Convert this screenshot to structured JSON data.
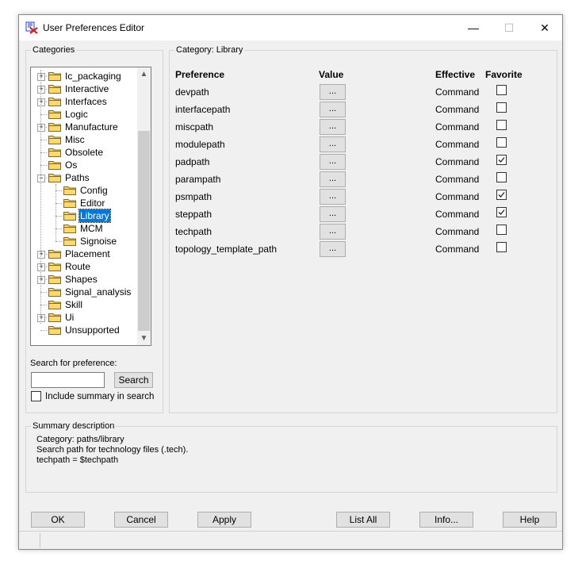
{
  "window": {
    "title": "User Preferences Editor",
    "minimize_glyph": "—",
    "maximize_glyph": "☐",
    "close_glyph": "✕"
  },
  "categories": {
    "label": "Categories",
    "tree": [
      {
        "label": "Ic_packaging",
        "level": 0,
        "expander": "+",
        "selected": false
      },
      {
        "label": "Interactive",
        "level": 0,
        "expander": "+",
        "selected": false
      },
      {
        "label": "Interfaces",
        "level": 0,
        "expander": "+",
        "selected": false
      },
      {
        "label": "Logic",
        "level": 0,
        "expander": "",
        "selected": false
      },
      {
        "label": "Manufacture",
        "level": 0,
        "expander": "+",
        "selected": false
      },
      {
        "label": "Misc",
        "level": 0,
        "expander": "",
        "selected": false
      },
      {
        "label": "Obsolete",
        "level": 0,
        "expander": "",
        "selected": false
      },
      {
        "label": "Os",
        "level": 0,
        "expander": "",
        "selected": false
      },
      {
        "label": "Paths",
        "level": 0,
        "expander": "−",
        "selected": false
      },
      {
        "label": "Config",
        "level": 1,
        "expander": "",
        "selected": false
      },
      {
        "label": "Editor",
        "level": 1,
        "expander": "",
        "selected": false
      },
      {
        "label": "Library",
        "level": 1,
        "expander": "",
        "selected": true
      },
      {
        "label": "MCM",
        "level": 1,
        "expander": "",
        "selected": false
      },
      {
        "label": "Signoise",
        "level": 1,
        "expander": "",
        "selected": false
      },
      {
        "label": "Placement",
        "level": 0,
        "expander": "+",
        "selected": false
      },
      {
        "label": "Route",
        "level": 0,
        "expander": "+",
        "selected": false
      },
      {
        "label": "Shapes",
        "level": 0,
        "expander": "+",
        "selected": false
      },
      {
        "label": "Signal_analysis",
        "level": 0,
        "expander": "",
        "selected": false
      },
      {
        "label": "Skill",
        "level": 0,
        "expander": "",
        "selected": false
      },
      {
        "label": "Ui",
        "level": 0,
        "expander": "+",
        "selected": false
      },
      {
        "label": "Unsupported",
        "level": 0,
        "expander": "",
        "selected": false
      }
    ]
  },
  "search": {
    "label": "Search for preference:",
    "value": "",
    "button": "Search",
    "include_summary_label": "Include summary in search",
    "include_summary_checked": false
  },
  "category_panel": {
    "label": "Category:  Library",
    "headers": {
      "preference": "Preference",
      "value": "Value",
      "effective": "Effective",
      "favorite": "Favorite"
    },
    "rows": [
      {
        "name": "devpath",
        "value_button": "...",
        "effective": "Command",
        "favorite": false
      },
      {
        "name": "interfacepath",
        "value_button": "...",
        "effective": "Command",
        "favorite": false
      },
      {
        "name": "miscpath",
        "value_button": "...",
        "effective": "Command",
        "favorite": false
      },
      {
        "name": "modulepath",
        "value_button": "...",
        "effective": "Command",
        "favorite": false
      },
      {
        "name": "padpath",
        "value_button": "...",
        "effective": "Command",
        "favorite": true
      },
      {
        "name": "parampath",
        "value_button": "...",
        "effective": "Command",
        "favorite": false
      },
      {
        "name": "psmpath",
        "value_button": "...",
        "effective": "Command",
        "favorite": true
      },
      {
        "name": "steppath",
        "value_button": "...",
        "effective": "Command",
        "favorite": true
      },
      {
        "name": "techpath",
        "value_button": "...",
        "effective": "Command",
        "favorite": false
      },
      {
        "name": "topology_template_path",
        "value_button": "...",
        "effective": "Command",
        "favorite": false
      }
    ]
  },
  "summary": {
    "label": "Summary description",
    "lines": [
      "Category: paths/library",
      "Search path for technology files (.tech).",
      "techpath = $techpath"
    ]
  },
  "buttons": {
    "ok": "OK",
    "cancel": "Cancel",
    "apply": "Apply",
    "list_all": "List All",
    "info": "Info...",
    "help": "Help"
  },
  "colors": {
    "selection": "#0078d7",
    "window_bg": "#f0f0f0",
    "folder": "#ffd86e",
    "app_icon_red": "#d4202a"
  }
}
